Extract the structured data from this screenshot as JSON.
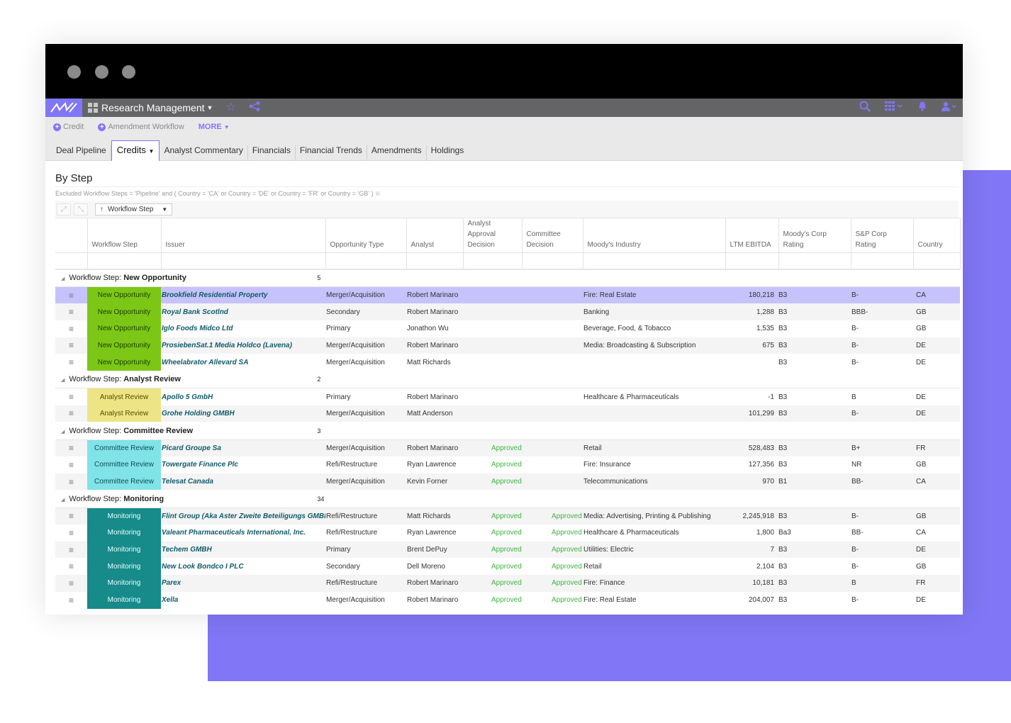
{
  "colors": {
    "accent": "#8176f5",
    "new_opportunity": "#7cc716",
    "analyst_review": "#ede486",
    "committee_review": "#7fe3e8",
    "monitoring": "#178a8a",
    "approved": "#3fb53f"
  },
  "app": {
    "title": "Research Management",
    "icons": [
      "logo-icon",
      "apps-grid-icon",
      "star-icon",
      "share-icon",
      "search-icon",
      "waffle-menu-icon",
      "bell-icon",
      "user-icon"
    ]
  },
  "subnav": {
    "credit": "Credit",
    "amendment": "Amendment Workflow",
    "more": "MORE"
  },
  "tabs": [
    {
      "label": "Deal Pipeline"
    },
    {
      "label": "Credits"
    },
    {
      "label": "Analyst Commentary"
    },
    {
      "label": "Financials"
    },
    {
      "label": "Financial Trends"
    },
    {
      "label": "Amendments"
    },
    {
      "label": "Holdings"
    }
  ],
  "view": {
    "title": "By Step",
    "filter": "Excluded Workflow Steps = 'Pipeline' and ( Country = 'CA' or Country = 'DE' or Country = 'FR' or Country = 'GB' )",
    "group_by": "Workflow Step"
  },
  "columns": {
    "workflow_step": "Workflow Step",
    "issuer": "Issuer",
    "opportunity_type": "Opportunity Type",
    "analyst": "Analyst",
    "analyst_approval_1": "Analyst",
    "analyst_approval_2": "Approval",
    "analyst_approval_3": "Decision",
    "committee_1": "Committee",
    "committee_2": "Decision",
    "moodys_industry": "Moody's Industry",
    "ltm_ebitda": "LTM EBITDA",
    "moodys_rating_1": "Moody's Corp",
    "moodys_rating_2": "Rating",
    "sp_rating_1": "S&P Corp",
    "sp_rating_2": "Rating",
    "country": "Country"
  },
  "groups": [
    {
      "prefix": "Workflow Step:",
      "name": "New Opportunity",
      "count": "5",
      "style": "new",
      "rows": [
        {
          "step": "New Opportunity",
          "issuer": "Brookfield Residential Property",
          "type": "Merger/Acquisition",
          "analyst": "Robert Marinaro",
          "aad": "",
          "cd": "",
          "industry": "Fire: Real Estate",
          "ebitda": "180,218",
          "moodys": "B3",
          "sp": "B-",
          "country": "CA",
          "selected": true
        },
        {
          "step": "New Opportunity",
          "issuer": "Royal Bank Scotlnd",
          "type": "Secondary",
          "analyst": "Robert Marinaro",
          "aad": "",
          "cd": "",
          "industry": "Banking",
          "ebitda": "1,288",
          "moodys": "B3",
          "sp": "BBB-",
          "country": "GB"
        },
        {
          "step": "New Opportunity",
          "issuer": "Iglo Foods Midco Ltd",
          "type": "Primary",
          "analyst": "Jonathon Wu",
          "aad": "",
          "cd": "",
          "industry": "Beverage, Food, & Tobacco",
          "ebitda": "1,535",
          "moodys": "B3",
          "sp": "B-",
          "country": "GB"
        },
        {
          "step": "New Opportunity",
          "issuer": "ProsiebenSat.1 Media Holdco (Lavena)",
          "type": "Merger/Acquisition",
          "analyst": "Robert Marinaro",
          "aad": "",
          "cd": "",
          "industry": "Media: Broadcasting & Subscription",
          "ebitda": "675",
          "moodys": "B3",
          "sp": "B-",
          "country": "DE"
        },
        {
          "step": "New Opportunity",
          "issuer": "Wheelabrator Allevard SA",
          "type": "Merger/Acquisition",
          "analyst": "Matt Richards",
          "aad": "",
          "cd": "",
          "industry": "",
          "ebitda": "",
          "moodys": "B3",
          "sp": "B-",
          "country": "DE"
        }
      ]
    },
    {
      "prefix": "Workflow Step:",
      "name": "Analyst Review",
      "count": "2",
      "style": "analyst",
      "rows": [
        {
          "step": "Analyst Review",
          "issuer": "Apollo 5 GmbH",
          "type": "Primary",
          "analyst": "Robert Marinaro",
          "aad": "",
          "cd": "",
          "industry": "Healthcare & Pharmaceuticals",
          "ebitda": "-1",
          "moodys": "B3",
          "sp": "B",
          "country": "DE"
        },
        {
          "step": "Analyst Review",
          "issuer": "Grohe Holding GMBH",
          "type": "Merger/Acquisition",
          "analyst": "Matt Anderson",
          "aad": "",
          "cd": "",
          "industry": "",
          "ebitda": "101,299",
          "moodys": "B3",
          "sp": "B-",
          "country": "DE"
        }
      ]
    },
    {
      "prefix": "Workflow Step:",
      "name": "Committee Review",
      "count": "3",
      "style": "committee",
      "rows": [
        {
          "step": "Committee Review",
          "issuer": "Picard Groupe Sa",
          "type": "Merger/Acquisition",
          "analyst": "Robert Marinaro",
          "aad": "Approved",
          "cd": "",
          "industry": "Retail",
          "ebitda": "528,483",
          "moodys": "B3",
          "sp": "B+",
          "country": "FR"
        },
        {
          "step": "Committee Review",
          "issuer": "Towergate Finance Plc",
          "type": "Refi/Restructure",
          "analyst": "Ryan Lawrence",
          "aad": "Approved",
          "cd": "",
          "industry": "Fire: Insurance",
          "ebitda": "127,356",
          "moodys": "B3",
          "sp": "NR",
          "country": "GB"
        },
        {
          "step": "Committee Review",
          "issuer": "Telesat Canada",
          "type": "Merger/Acquisition",
          "analyst": "Kevin Forner",
          "aad": "Approved",
          "cd": "",
          "industry": "Telecommunications",
          "ebitda": "970",
          "moodys": "B1",
          "sp": "BB-",
          "country": "CA"
        }
      ]
    },
    {
      "prefix": "Workflow Step:",
      "name": "Monitoring",
      "count": "34",
      "style": "monitor",
      "rows": [
        {
          "step": "Monitoring",
          "issuer": "Flint Group (Aka Aster Zweite Beteiligungs GMBH)",
          "type": "Refi/Restructure",
          "analyst": "Matt Richards",
          "aad": "Approved",
          "cd": "Approved",
          "industry": "Media: Advertising, Printing & Publishing",
          "ebitda": "2,245,918",
          "moodys": "B3",
          "sp": "B-",
          "country": "GB"
        },
        {
          "step": "Monitoring",
          "issuer": "Valeant Pharmaceuticals International, Inc.",
          "type": "Refi/Restructure",
          "analyst": "Ryan Lawrence",
          "aad": "Approved",
          "cd": "Approved",
          "industry": "Healthcare & Pharmaceuticals",
          "ebitda": "1,800",
          "moodys": "Ba3",
          "sp": "BB-",
          "country": "CA"
        },
        {
          "step": "Monitoring",
          "issuer": "Techem GMBH",
          "type": "Primary",
          "analyst": "Brent DePuy",
          "aad": "Approved",
          "cd": "Approved",
          "industry": "Utilities: Electric",
          "ebitda": "7",
          "moodys": "B3",
          "sp": "B-",
          "country": "DE"
        },
        {
          "step": "Monitoring",
          "issuer": "New Look Bondco I PLC",
          "type": "Secondary",
          "analyst": "Dell Moreno",
          "aad": "Approved",
          "cd": "Approved",
          "industry": "Retail",
          "ebitda": "2,104",
          "moodys": "B3",
          "sp": "B-",
          "country": "GB"
        },
        {
          "step": "Monitoring",
          "issuer": "Parex",
          "type": "Refi/Restructure",
          "analyst": "Robert Marinaro",
          "aad": "Approved",
          "cd": "Approved",
          "industry": "Fire: Finance",
          "ebitda": "10,181",
          "moodys": "B3",
          "sp": "B",
          "country": "FR"
        },
        {
          "step": "Monitoring",
          "issuer": "Xella",
          "type": "Merger/Acquisition",
          "analyst": "Robert Marinaro",
          "aad": "Approved",
          "cd": "Approved",
          "industry": "Fire: Real Estate",
          "ebitda": "204,007",
          "moodys": "B3",
          "sp": "B-",
          "country": "DE"
        }
      ]
    }
  ]
}
